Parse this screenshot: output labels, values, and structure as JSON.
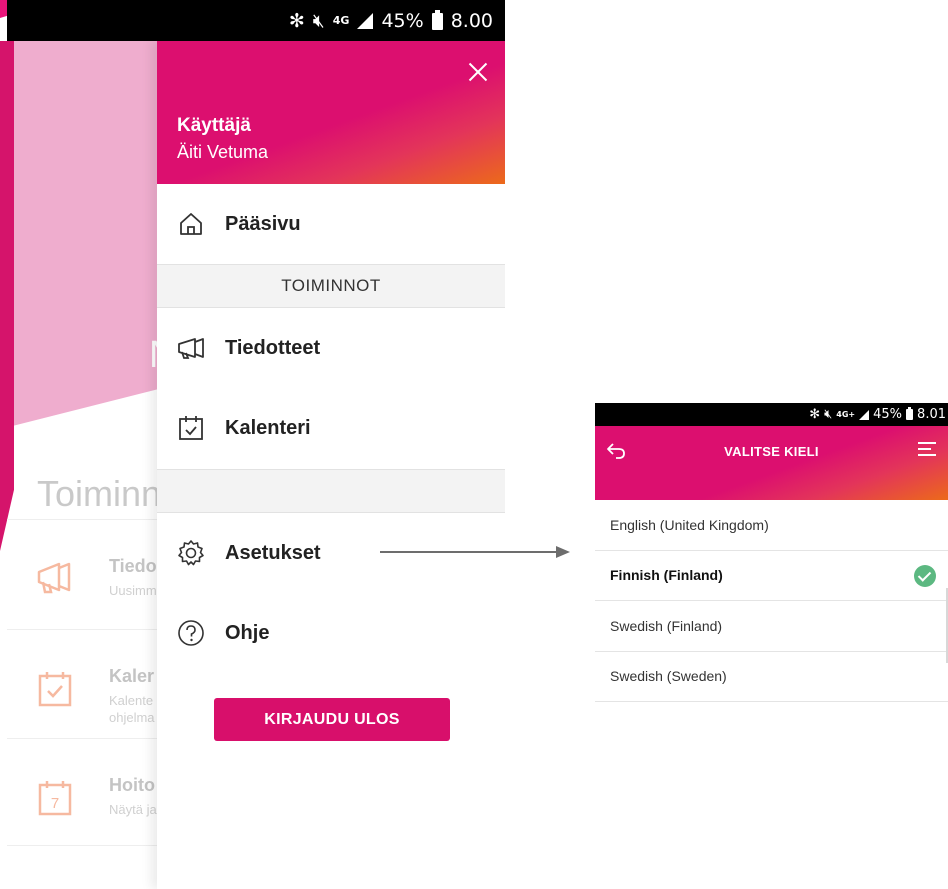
{
  "left_phone": {
    "status_bar": {
      "network": "4G",
      "battery": "45%",
      "time": "8.00"
    },
    "background": {
      "header_fragment": "N",
      "section_title": "Toiminn",
      "rows": [
        {
          "title": "Tiedo",
          "subtitle": "Uusimm",
          "icon": "megaphone-icon"
        },
        {
          "title": "Kaler",
          "subtitle": "Kalente ohjelma",
          "icon": "calendar-check-icon"
        },
        {
          "title": "Hoito",
          "subtitle": "Näytä ja",
          "icon": "calendar-number-icon"
        }
      ]
    },
    "drawer": {
      "user_label": "Käyttäjä",
      "user_name": "Äiti Vetuma",
      "home_label": "Pääsivu",
      "section_label": "TOIMINNOT",
      "items": [
        {
          "label": "Tiedotteet",
          "icon": "megaphone-icon"
        },
        {
          "label": "Kalenteri",
          "icon": "calendar-icon"
        },
        {
          "label": "Asetukset",
          "icon": "gear-icon"
        },
        {
          "label": "Ohje",
          "icon": "help-icon"
        }
      ],
      "logout_label": "KIRJAUDU ULOS"
    }
  },
  "right_phone": {
    "status_bar": {
      "network": "4G+",
      "battery": "45%",
      "time": "8.01"
    },
    "title": "VALITSE KIELI",
    "languages": [
      {
        "label": "English (United Kingdom)",
        "selected": false
      },
      {
        "label": "Finnish (Finland)",
        "selected": true
      },
      {
        "label": "Swedish (Finland)",
        "selected": false
      },
      {
        "label": "Swedish (Sweden)",
        "selected": false
      }
    ]
  },
  "colors": {
    "brand": "#d80f6b",
    "accent_orange": "#ec6a1a",
    "check_green": "#5cb881",
    "pink_bg": "#efadce"
  }
}
